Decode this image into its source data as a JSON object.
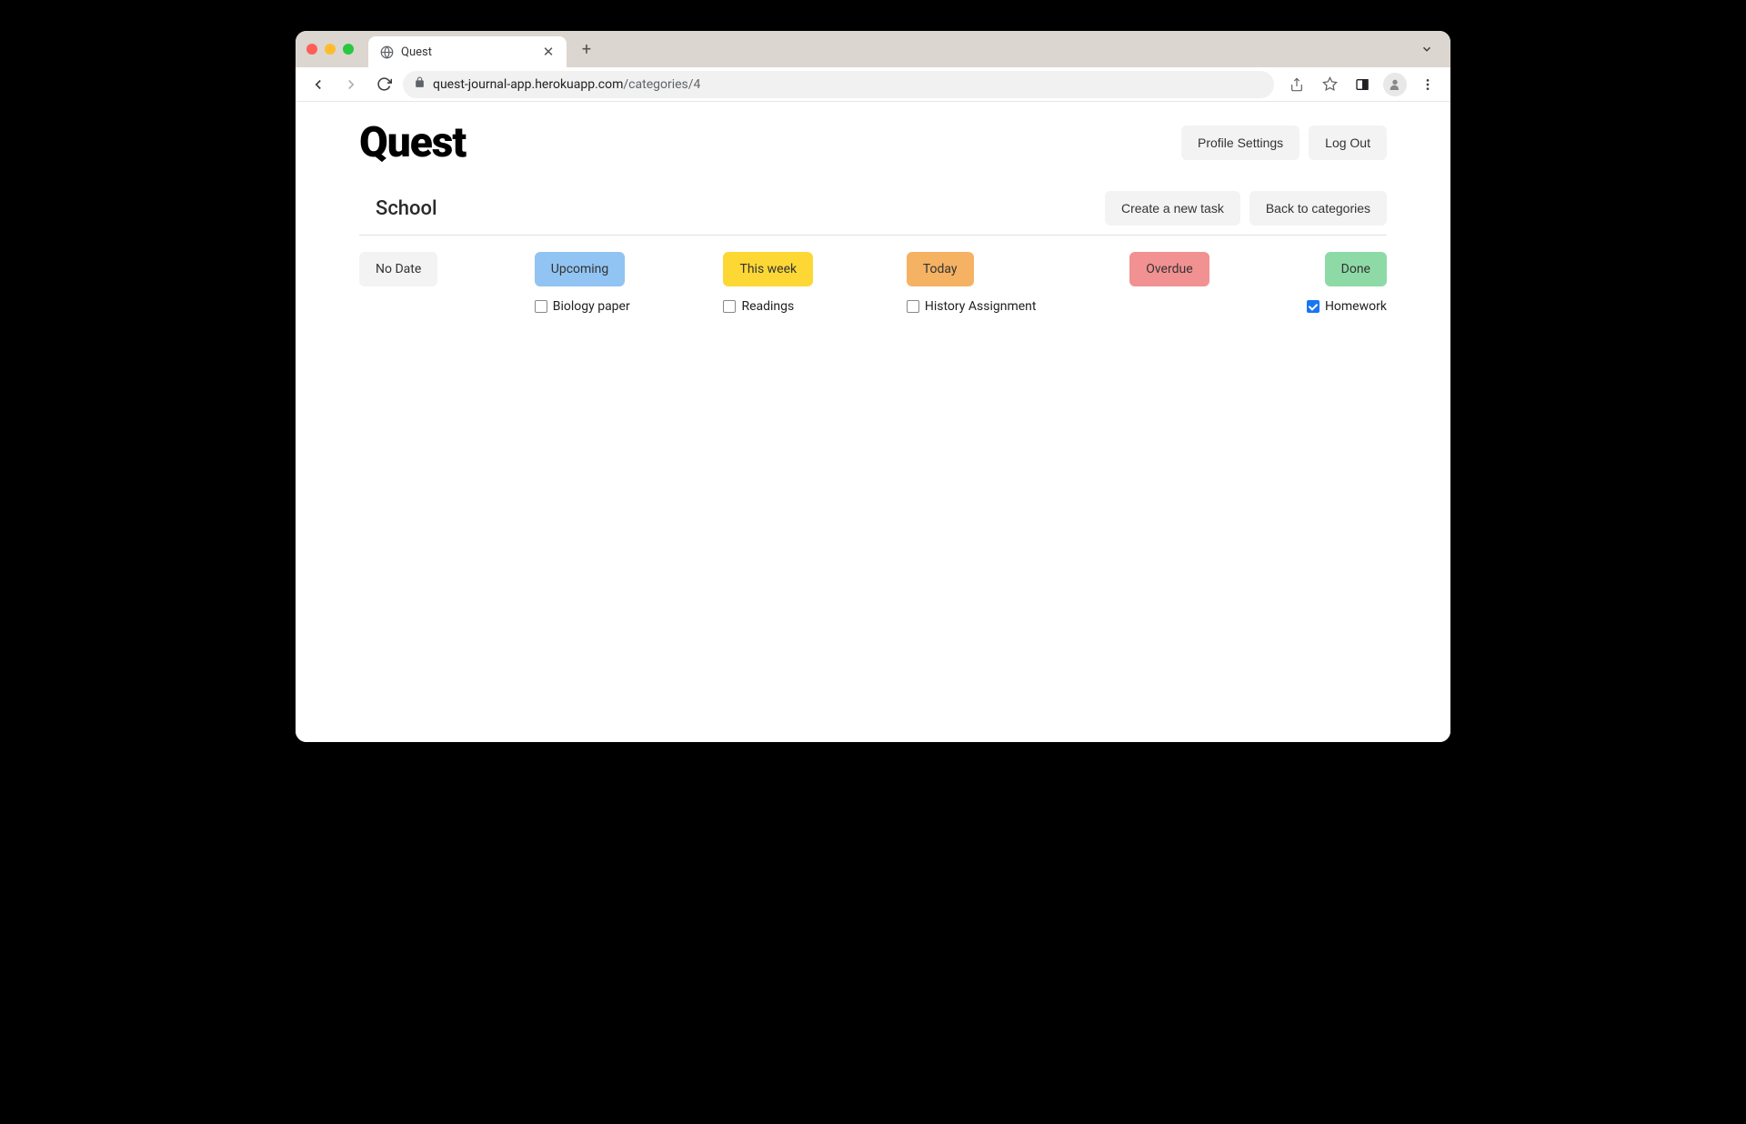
{
  "browser": {
    "tab_title": "Quest",
    "url_host": "quest-journal-app.herokuapp.com",
    "url_path": "/categories/4"
  },
  "app": {
    "logo": "Quest",
    "header_buttons": {
      "profile": "Profile Settings",
      "logout": "Log Out"
    },
    "category": {
      "title": "School",
      "create_task": "Create a new task",
      "back": "Back to categories"
    },
    "columns": {
      "no_date": {
        "label": "No Date"
      },
      "upcoming": {
        "label": "Upcoming",
        "task": "Biology paper"
      },
      "this_week": {
        "label": "This week",
        "task": "Readings"
      },
      "today": {
        "label": "Today",
        "task": "History Assignment"
      },
      "overdue": {
        "label": "Overdue"
      },
      "done": {
        "label": "Done",
        "task": "Homework"
      }
    }
  }
}
